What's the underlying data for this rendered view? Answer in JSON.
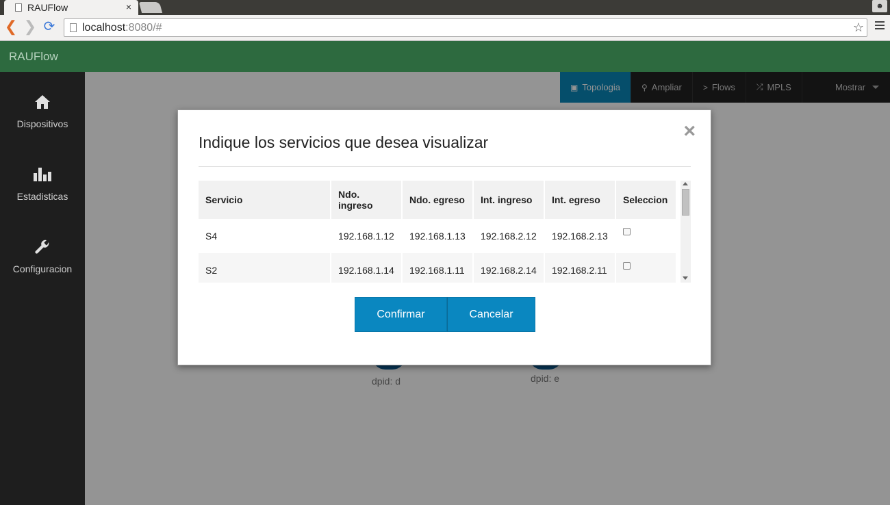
{
  "browser": {
    "tab_title": "RAUFlow",
    "tab_close": "×",
    "url_host": "localhost",
    "url_rest": ":8080/#"
  },
  "app": {
    "brand": "RAUFlow"
  },
  "sidebar": {
    "items": [
      {
        "label": "Dispositivos",
        "icon": "home-icon"
      },
      {
        "label": "Estadisticas",
        "icon": "bar-chart-icon"
      },
      {
        "label": "Configuracion",
        "icon": "wrench-icon"
      }
    ]
  },
  "topnav": {
    "items": [
      {
        "label": "Topologia",
        "icon": "picture-icon",
        "active": true
      },
      {
        "label": "Ampliar",
        "icon": "search-icon"
      },
      {
        "label": "Flows",
        "icon": "chevron-right-icon"
      },
      {
        "label": "MPLS",
        "icon": "shuffle-icon"
      },
      {
        "label": "Mostrar",
        "icon": "caret-down-icon"
      }
    ]
  },
  "topology": {
    "nodes": [
      {
        "label": "dpid: d"
      },
      {
        "label": "dpid: e"
      }
    ]
  },
  "modal": {
    "title": "Indique los servicios que desea visualizar",
    "close": "×",
    "table": {
      "headers": [
        "Servicio",
        "Ndo. ingreso",
        "Ndo. egreso",
        "Int. ingreso",
        "Int. egreso",
        "Seleccion"
      ],
      "rows": [
        {
          "servicio": "S4",
          "ndo_ingreso": "192.168.1.12",
          "ndo_egreso": "192.168.1.13",
          "int_ingreso": "192.168.2.12",
          "int_egreso": "192.168.2.13",
          "selected": false
        },
        {
          "servicio": "S2",
          "ndo_ingreso": "192.168.1.14",
          "ndo_egreso": "192.168.1.11",
          "int_ingreso": "192.168.2.14",
          "int_egreso": "192.168.2.11",
          "selected": false
        }
      ]
    },
    "confirm_label": "Confirmar",
    "cancel_label": "Cancelar"
  },
  "colors": {
    "header_green": "#2d6a3f",
    "accent_blue": "#0a87c0",
    "sidebar_dark": "#1e1e1e"
  }
}
